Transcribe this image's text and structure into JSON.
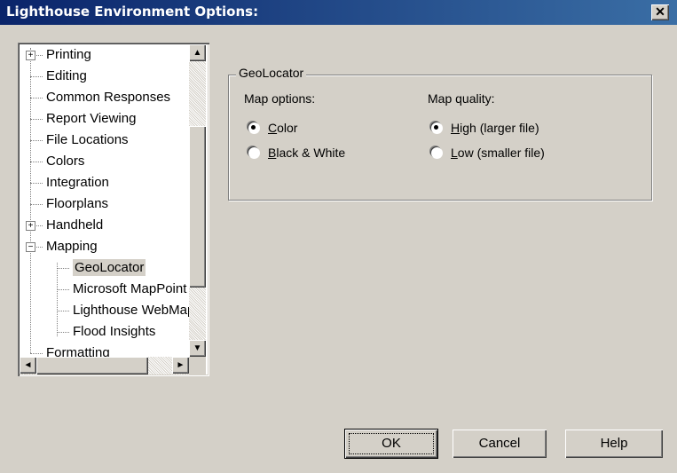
{
  "window": {
    "title": "Lighthouse Environment Options:",
    "close_icon": "close-icon"
  },
  "tree": {
    "items": [
      {
        "label": "Printing",
        "expander": "+"
      },
      {
        "label": "Editing"
      },
      {
        "label": "Common Responses"
      },
      {
        "label": "Report Viewing"
      },
      {
        "label": "File Locations"
      },
      {
        "label": "Colors"
      },
      {
        "label": "Integration"
      },
      {
        "label": "Floorplans"
      },
      {
        "label": "Handheld",
        "expander": "+"
      },
      {
        "label": "Mapping",
        "expander": "−"
      },
      {
        "label": "GeoLocator",
        "selected": true
      },
      {
        "label": "Microsoft MapPoint"
      },
      {
        "label": "Lighthouse WebMap"
      },
      {
        "label": "Flood Insights"
      },
      {
        "label": "Formatting"
      }
    ],
    "scroll_up": "▲",
    "scroll_down": "▼",
    "scroll_left": "◄",
    "scroll_right": "►"
  },
  "geolocator": {
    "group_title": "GeoLocator",
    "map_options_label": "Map options:",
    "map_quality_label": "Map quality:",
    "options": [
      {
        "accel": "C",
        "rest": "olor",
        "checked": true
      },
      {
        "accel": "B",
        "rest": "lack & White",
        "checked": false
      }
    ],
    "quality": [
      {
        "accel": "H",
        "rest": "igh (larger file)",
        "checked": true
      },
      {
        "accel": "L",
        "rest": "ow (smaller file)",
        "checked": false
      }
    ]
  },
  "buttons": {
    "ok": "OK",
    "cancel": "Cancel",
    "help": "Help"
  }
}
